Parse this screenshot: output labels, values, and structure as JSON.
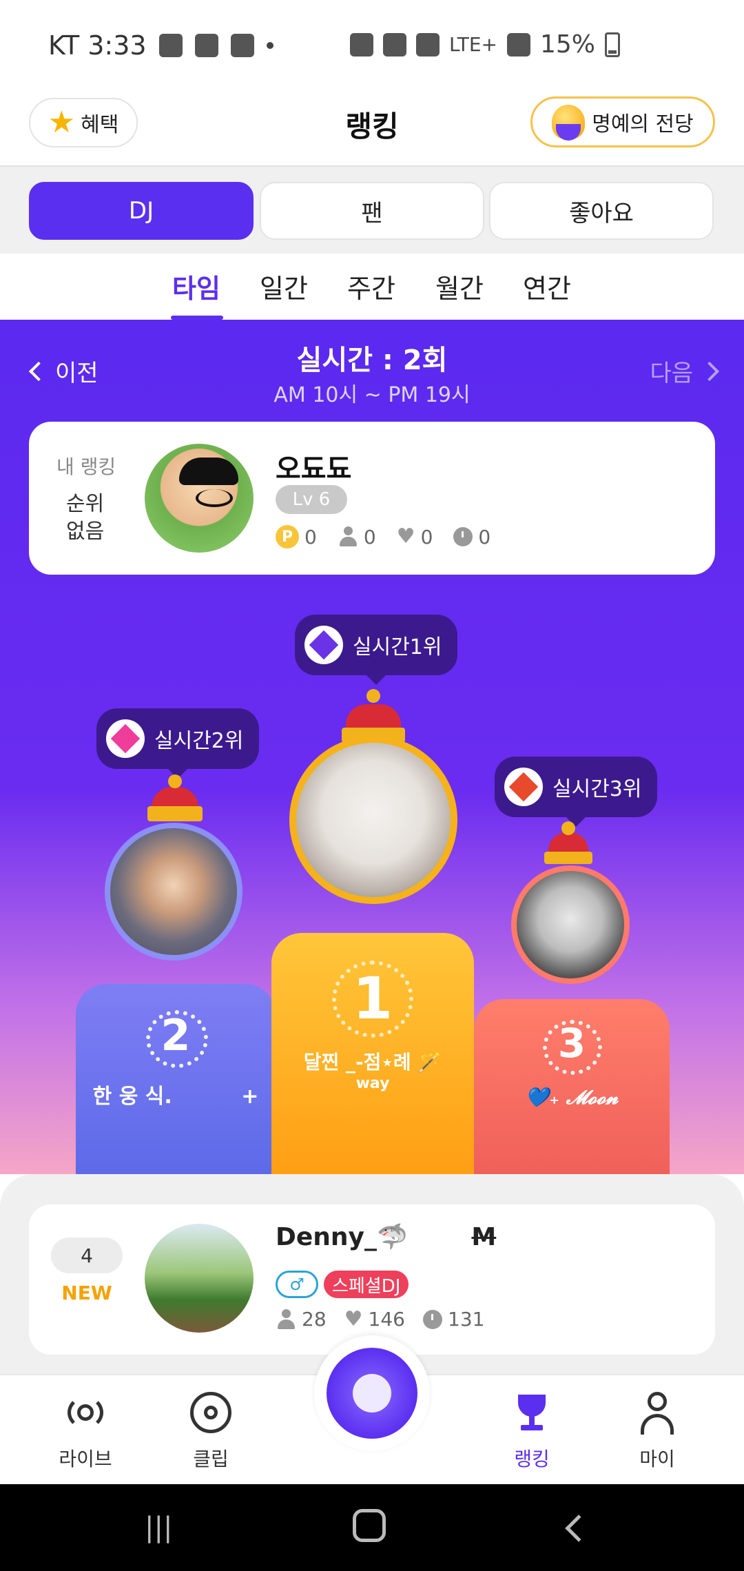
{
  "status_bar": {
    "carrier_time": "KT 3:33",
    "battery": "15%",
    "network": "LTE+"
  },
  "header": {
    "benefit_label": "혜택",
    "title": "랭킹",
    "hall_of_fame_label": "명예의 전당"
  },
  "category_tabs": [
    {
      "label": "DJ",
      "active": true
    },
    {
      "label": "팬",
      "active": false
    },
    {
      "label": "좋아요",
      "active": false
    }
  ],
  "period_tabs": [
    {
      "label": "타임",
      "active": true
    },
    {
      "label": "일간",
      "active": false
    },
    {
      "label": "주간",
      "active": false
    },
    {
      "label": "월간",
      "active": false
    },
    {
      "label": "연간",
      "active": false
    }
  ],
  "round_nav": {
    "prev_label": "이전",
    "next_label": "다음",
    "title": "실시간 : 2회",
    "subtitle": "AM 10시 ~ PM 19시"
  },
  "my_ranking": {
    "label": "내 랭킹",
    "rank_line1": "순위",
    "rank_line2": "없음",
    "name": "오됴됴",
    "level": "Lv 6",
    "coins_icon": "P",
    "coins": "0",
    "listeners": "0",
    "likes": "0",
    "time": "0"
  },
  "podium": {
    "first": {
      "bubble": "실시간1위",
      "rank": "1",
      "name": "달찐 _-점⋆례 🪄",
      "sub": "way"
    },
    "second": {
      "bubble": "실시간2위",
      "rank": "2",
      "name": "한 웅 식.",
      "sub": "+"
    },
    "third": {
      "bubble": "실시간3위",
      "rank": "3",
      "name": "💙₊ 𝓜𝓸𝓸𝓷",
      "sub": ""
    }
  },
  "list": [
    {
      "rank": "4",
      "status": "NEW",
      "name": "Denny_🦈",
      "name_suffix": "M",
      "gender_badge": "♂",
      "special_badge": "스페셜DJ",
      "listeners": "28",
      "likes": "146",
      "time": "131"
    }
  ],
  "bottom_nav": [
    {
      "label": "라이브",
      "icon": "broadcast-icon"
    },
    {
      "label": "클립",
      "icon": "disc-icon"
    },
    {
      "label": "랭킹",
      "icon": "trophy-icon",
      "active": true
    },
    {
      "label": "마이",
      "icon": "person-icon"
    }
  ],
  "colors": {
    "accent": "#5b2ff0",
    "gold": "#f5a200",
    "special": "#ee3f5b"
  }
}
